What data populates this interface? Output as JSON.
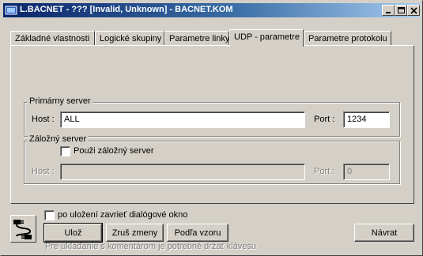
{
  "window": {
    "title": "L.BACNET - ??? [Invalid, Unknown] - BACNET.KOM"
  },
  "titlebar_buttons": [
    "minimize-icon",
    "maximize-icon",
    "close-icon"
  ],
  "tabs": [
    {
      "label": "Základné vlastnosti",
      "active": false
    },
    {
      "label": "Logické skupiny",
      "active": false
    },
    {
      "label": "Parametre linky",
      "active": false
    },
    {
      "label": "UDP - parametre",
      "active": true
    },
    {
      "label": "Parametre protokolu",
      "active": false
    }
  ],
  "primary_server": {
    "group_title": "Primárny server",
    "host_label": "Host :",
    "host_value": "ALL",
    "port_label": "Port :",
    "port_value": "1234"
  },
  "backup_server": {
    "group_title": "Záložný server",
    "use_checkbox_label": "Použi záložný server",
    "use_checked": false,
    "host_label": "Host :",
    "host_value": "",
    "port_label": "Port :",
    "port_value": "0"
  },
  "footer": {
    "close_after_save_label": "po uložení zavrieť dialógové okno",
    "close_after_save_checked": false,
    "save_label": "Ulož",
    "cancel_changes_label": "Zruš zmeny",
    "by_template_label": "Podľa vzoru",
    "return_label": "Návrat",
    "hint": "Pre ukladanie s komentárom je potrebné držať klávesu"
  },
  "colors": {
    "title_gradient_start": "#0a246a",
    "title_gradient_end": "#a6caf0",
    "face": "#d4d0c8"
  }
}
